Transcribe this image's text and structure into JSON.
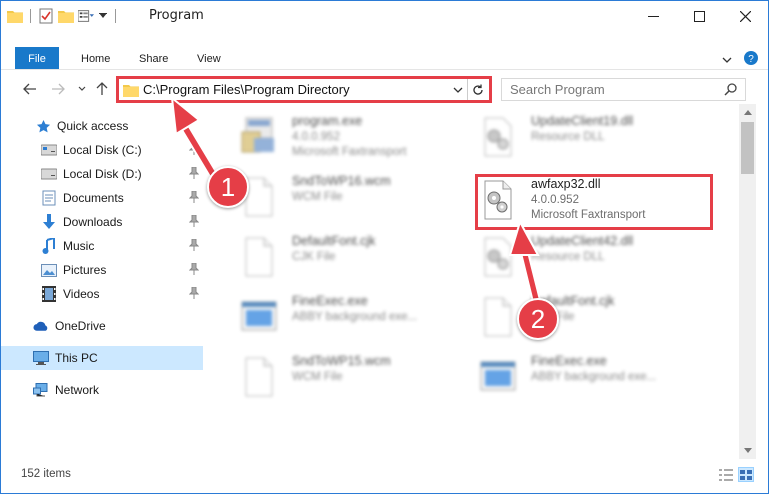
{
  "window": {
    "title": "Program"
  },
  "ribbon": {
    "tabs": [
      "File",
      "Home",
      "Share",
      "View"
    ]
  },
  "address": {
    "path": "C:\\Program Files\\Program Directory"
  },
  "search": {
    "placeholder": "Search Program"
  },
  "sidebar": {
    "items": [
      {
        "label": "Quick access",
        "icon": "star-icon"
      },
      {
        "label": "Local Disk (C:)",
        "icon": "drive-icon",
        "pinned": true
      },
      {
        "label": "Local Disk (D:)",
        "icon": "drive-icon",
        "pinned": true
      },
      {
        "label": "Documents",
        "icon": "documents-icon",
        "pinned": true
      },
      {
        "label": "Downloads",
        "icon": "download-icon",
        "pinned": true
      },
      {
        "label": "Music",
        "icon": "music-icon",
        "pinned": true
      },
      {
        "label": "Pictures",
        "icon": "pictures-icon",
        "pinned": true
      },
      {
        "label": "Videos",
        "icon": "videos-icon",
        "pinned": true
      },
      {
        "label": "OneDrive",
        "icon": "cloud-icon"
      },
      {
        "label": "This PC",
        "icon": "computer-icon",
        "selected": true
      },
      {
        "label": "Network",
        "icon": "network-icon"
      }
    ]
  },
  "files": [
    {
      "name": "program.exe",
      "line2": "4.0.0.952",
      "line3": "Microsoft Faxtransport",
      "icon": "exe-icon"
    },
    {
      "name": "UpdateClient19.dll",
      "line2": "Resource DLL",
      "line3": "",
      "icon": "dll-icon"
    },
    {
      "name": "SndToWP16.wcm",
      "line2": "WCM File",
      "line3": "",
      "icon": "file-icon"
    },
    {
      "name": "awfaxp32.dll",
      "line2": "4.0.0.952",
      "line3": "Microsoft Faxtransport",
      "icon": "dll-icon"
    },
    {
      "name": "DefaultFont.cjk",
      "line2": "CJK File",
      "line3": "",
      "icon": "file-icon"
    },
    {
      "name": "UpdateClient42.dll",
      "line2": "Resource DLL",
      "line3": "",
      "icon": "dll-icon"
    },
    {
      "name": "FineExec.exe",
      "line2": "ABBY background exe...",
      "line3": "",
      "icon": "window-icon"
    },
    {
      "name": "DefaultFont.cjk",
      "line2": "CJK File",
      "line3": "",
      "icon": "file-icon"
    },
    {
      "name": "SndToWP15.wcm",
      "line2": "WCM File",
      "line3": "",
      "icon": "file-icon"
    },
    {
      "name": "FineExec.exe",
      "line2": "ABBY background exe...",
      "line3": "",
      "icon": "window-icon"
    }
  ],
  "status": {
    "item_count": "152 items"
  },
  "annotations": {
    "step1": "1",
    "step2": "2"
  },
  "colors": {
    "accent": "#1979ca",
    "highlight": "#e53e47",
    "selected": "#cce8ff"
  }
}
